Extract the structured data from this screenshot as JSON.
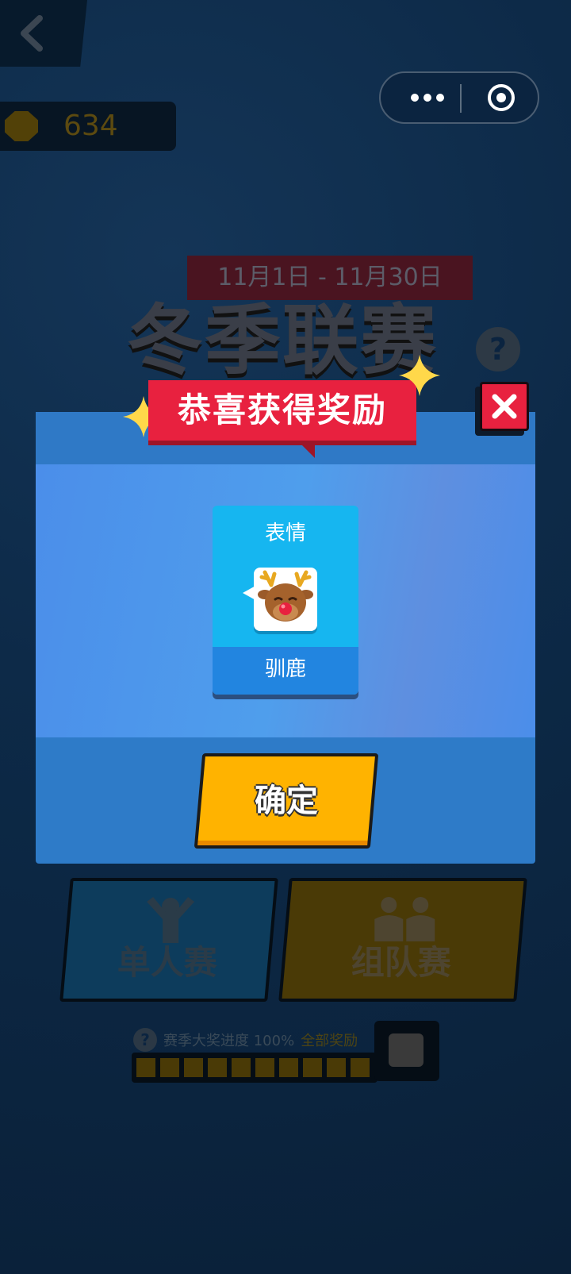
{
  "top_bar": {
    "coin_count": "634"
  },
  "season": {
    "date_range": "11月1日 - 11月30日",
    "title": "冬季联赛",
    "help_label": "?"
  },
  "modes": {
    "solo_label": "单人赛",
    "team_label": "组队赛"
  },
  "progress": {
    "help_label": "?",
    "text": "赛季大奖进度 100%",
    "accent_text": "全部奖励",
    "segments": 10,
    "fraction": 1.0
  },
  "modal": {
    "title": "恭喜获得奖励",
    "reward": {
      "type_label": "表情",
      "name": "驯鹿"
    },
    "confirm_label": "确定"
  },
  "colors": {
    "ribbon": "#e8213f",
    "confirm": "#ffb300",
    "card_top": "#16b6f0",
    "card_bottom": "#2285e0",
    "modal": "#2e7bc8"
  },
  "icons": [
    "back-arrow-icon",
    "coin-icon",
    "more-dots-icon",
    "target-circle-icon",
    "close-icon",
    "sparkle-icon",
    "reindeer-emoji-icon",
    "solo-person-icon",
    "team-people-icon"
  ]
}
